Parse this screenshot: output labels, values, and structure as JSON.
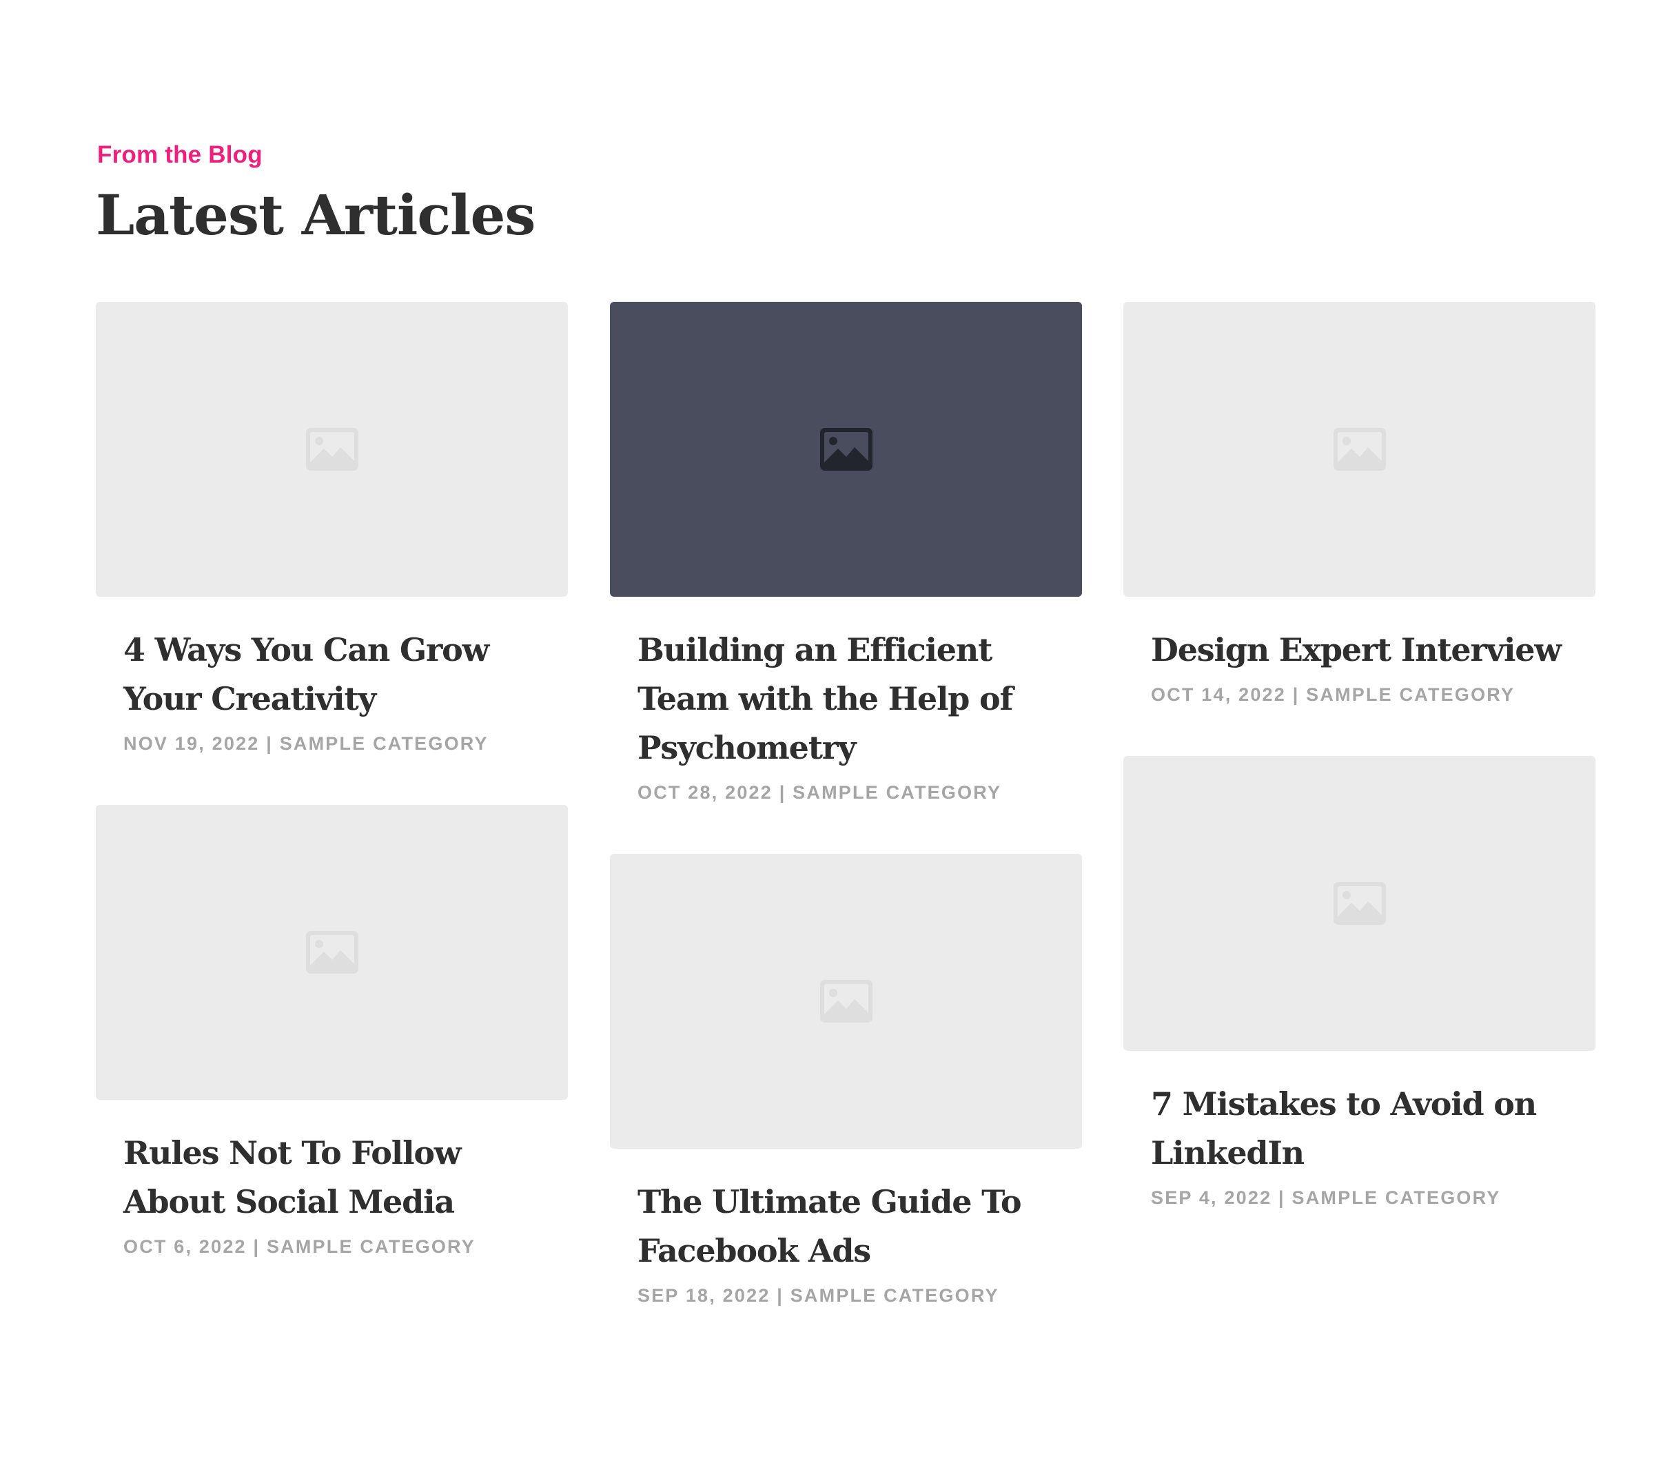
{
  "section": {
    "eyebrow": "From the Blog",
    "heading": "Latest Articles"
  },
  "colors": {
    "accent": "#ee1f7d",
    "heading": "#2f2f2f",
    "meta": "#a5a5a5",
    "thumb_light": "#ebebeb",
    "thumb_dark": "#4a4d5d"
  },
  "articles": [
    {
      "title": "4 Ways You Can Grow Your Creativity",
      "date": "NOV 19, 2022",
      "separator": " | ",
      "category": "SAMPLE CATEGORY",
      "thumbnail_icon": "image-placeholder-icon",
      "thumbnail_state": "default"
    },
    {
      "title": "Building an Efficient Team with the Help of Psychometry",
      "date": "OCT 28, 2022",
      "separator": " | ",
      "category": "SAMPLE CATEGORY",
      "thumbnail_icon": "image-placeholder-icon",
      "thumbnail_state": "hover"
    },
    {
      "title": "Design Expert Interview",
      "date": "OCT 14, 2022",
      "separator": " | ",
      "category": "SAMPLE CATEGORY",
      "thumbnail_icon": "image-placeholder-icon",
      "thumbnail_state": "default"
    },
    {
      "title": "Rules Not To Follow About Social Media",
      "date": "OCT 6, 2022",
      "separator": " | ",
      "category": "SAMPLE CATEGORY",
      "thumbnail_icon": "image-placeholder-icon",
      "thumbnail_state": "default"
    },
    {
      "title": "The Ultimate Guide To Facebook Ads",
      "date": "SEP 18, 2022",
      "separator": " | ",
      "category": "SAMPLE CATEGORY",
      "thumbnail_icon": "image-placeholder-icon",
      "thumbnail_state": "default"
    },
    {
      "title": "7 Mistakes to Avoid on LinkedIn",
      "date": "SEP 4, 2022",
      "separator": " | ",
      "category": "SAMPLE CATEGORY",
      "thumbnail_icon": "image-placeholder-icon",
      "thumbnail_state": "default"
    }
  ]
}
